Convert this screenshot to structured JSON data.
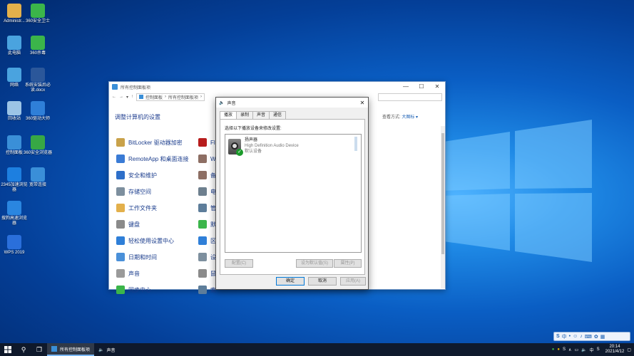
{
  "desktop": {
    "icons": [
      {
        "label": "Administr...",
        "icon": "user-folder-icon",
        "color": "#e3b04b"
      },
      {
        "label": "360安全卫士",
        "icon": "360-safe-icon",
        "color": "#3bb54a"
      },
      {
        "label": "此电脑",
        "icon": "computer-icon",
        "color": "#4aa3df"
      },
      {
        "label": "360杀毒",
        "icon": "360-antivirus-icon",
        "color": "#3bb54a"
      },
      {
        "label": "网络",
        "icon": "network-icon",
        "color": "#4aa3df"
      },
      {
        "label": "系统安装后必读.docx",
        "icon": "word-doc-icon",
        "color": "#2b579a"
      },
      {
        "label": "回收站",
        "icon": "recycle-bin-icon",
        "color": "#9cc4e6"
      },
      {
        "label": "360驱动大师",
        "icon": "360-driver-icon",
        "color": "#2f7fd8"
      },
      {
        "label": "控制面板",
        "icon": "control-panel-icon",
        "color": "#3a8fd8"
      },
      {
        "label": "360安全浏览器",
        "icon": "360-browser-icon",
        "color": "#37a845"
      },
      {
        "label": "2345加速浏览器",
        "icon": "2345-browser-icon",
        "color": "#1d7fe0"
      },
      {
        "label": "宽带连接",
        "icon": "broadband-icon",
        "color": "#3a8fd8"
      },
      {
        "label": "搜狗高速浏览器",
        "icon": "sogou-browser-icon",
        "color": "#2a86e0"
      },
      {
        "label": "WPS 2019",
        "icon": "wps-icon",
        "color": "#2a6fdb"
      }
    ]
  },
  "control_panel": {
    "title": "所有控制面板项",
    "address": {
      "part1": "控制面板",
      "part2": "所有控制面板项"
    },
    "heading": "调整计算机的设置",
    "view_label": "查看方式:",
    "view_value": "大图标 ▾",
    "left_items": [
      {
        "label": "BitLocker 驱动器加密",
        "color": "#c9a24a"
      },
      {
        "label": "RemoteApp 和桌面连接",
        "color": "#3a7bd5"
      },
      {
        "label": "安全和维护",
        "color": "#2e6fc9"
      },
      {
        "label": "存储空间",
        "color": "#7d8f9e"
      },
      {
        "label": "工作文件夹",
        "color": "#e3b04b"
      },
      {
        "label": "键盘",
        "color": "#8a8a8a"
      },
      {
        "label": "轻松使用设置中心",
        "color": "#2f7fd8"
      },
      {
        "label": "日期和时间",
        "color": "#4a90d9"
      },
      {
        "label": "声音",
        "color": "#9a9a9a"
      },
      {
        "label": "同步中心",
        "color": "#3bb54a"
      }
    ],
    "right_items": [
      {
        "label": "Fl",
        "color": "#b71c1c"
      },
      {
        "label": "W",
        "color": "#8d6e63"
      },
      {
        "label": "备",
        "color": "#8d6e63"
      },
      {
        "label": "电",
        "color": "#6d7f8e"
      },
      {
        "label": "管",
        "color": "#5d7d9a"
      },
      {
        "label": "默",
        "color": "#3bb54a"
      },
      {
        "label": "区",
        "color": "#2f7fd8"
      },
      {
        "label": "设",
        "color": "#7d8f9e"
      },
      {
        "label": "鼠",
        "color": "#8a8a8a"
      },
      {
        "label": "索",
        "color": "#5d7d9a"
      }
    ]
  },
  "sound_dialog": {
    "title": "声音",
    "tabs": [
      "播放",
      "录制",
      "声音",
      "通信"
    ],
    "instruction": "选择以下播放设备来修改设置:",
    "device": {
      "name": "扬声器",
      "driver": "High Definition Audio Device",
      "status": "默认设备"
    },
    "buttons": {
      "configure": "配置(C)",
      "set_default": "设为默认值(S)",
      "properties": "属性(P)",
      "ok": "确定",
      "cancel": "取消",
      "apply": "应用(A)"
    }
  },
  "taskbar": {
    "task_label": "所有控制面板项",
    "task2_label": "声音",
    "time": "20:14",
    "date": "2021/4/12"
  },
  "ime": {
    "label": "中"
  }
}
